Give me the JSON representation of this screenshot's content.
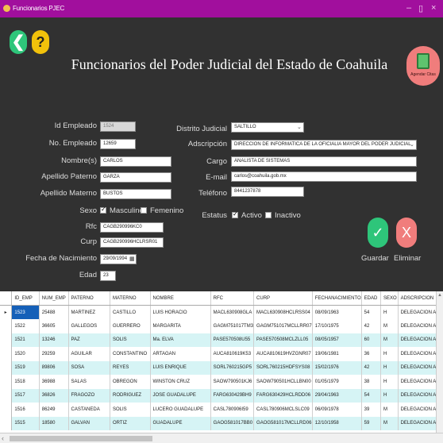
{
  "window": {
    "title": "Funcionarios PJEC",
    "min": "–",
    "max": "▯",
    "close": "×"
  },
  "header": {
    "back_glyph": "❮",
    "help_glyph": "?",
    "title": "Funcionarios del Poder Judicial del Estado de Coahuila",
    "badge_text": "Agendar Citas"
  },
  "form": {
    "id_empleado": {
      "label": "Id Empleado",
      "value": "1524"
    },
    "no_empleado": {
      "label": "No. Empleado",
      "value": "12659"
    },
    "nombre": {
      "label": "Nombre(s)",
      "value": "CARLOS"
    },
    "apellido_paterno": {
      "label": "Apellido Paterno",
      "value": "GARZA"
    },
    "apellido_materno": {
      "label": "Apellido Materno",
      "value": "BUSTOS"
    },
    "sexo": {
      "label": "Sexo",
      "opt1": "Masculino",
      "opt2": "Femenino"
    },
    "rfc": {
      "label": "Rfc",
      "value": "CAGB290996KC0"
    },
    "curp": {
      "label": "Curp",
      "value": "CAGB290996HCLRSR01"
    },
    "fecha_nac": {
      "label": "Fecha de Nacimiento",
      "value": "29/09/1994"
    },
    "edad": {
      "label": "Edad",
      "value": "23"
    },
    "distrito": {
      "label": "Distrito Judicial",
      "value": "SALTILLO"
    },
    "adscripcion": {
      "label": "Adscripción",
      "value": "DIRECCION DE INFORMATICA DE LA OFICIALIA MAYOR DEL PODER JUDICIAL"
    },
    "cargo": {
      "label": "Cargo",
      "value": "ANALISTA DE SISTEMAS"
    },
    "email": {
      "label": "E-mail",
      "value": "carlos@coahuila.gob.mx"
    },
    "telefono": {
      "label": "Teléfono",
      "value": "8441237878"
    },
    "estatus": {
      "label": "Estatus",
      "opt1": "Activo",
      "opt2": "Inactivo"
    }
  },
  "actions": {
    "save_glyph": "✓",
    "save_label": "Guardar",
    "delete_glyph": "X",
    "delete_label": "Eliminar"
  },
  "table": {
    "columns": [
      "ID_EMP",
      "NUM_EMP",
      "PATERNO",
      "MATERNO",
      "NOMBRE",
      "RFC",
      "CURP",
      "FECHANACIMIENTO",
      "EDAD",
      "SEXO",
      "ADSCRIPCION"
    ],
    "rows": [
      [
        "1523",
        "25488",
        "MARTINEZ",
        "CASTILLO",
        "LUIS HORACIO",
        "MACL630908GLA",
        "MACL630908HCLRSS04",
        "08/09/1963",
        "54",
        "H",
        "DELEGACION ACL"
      ],
      [
        "1522",
        "36605",
        "GALLEGOS",
        "GUERRERO",
        "MARGARITA",
        "GAGM751017TM3",
        "GAGM751017MCLLRR07",
        "17/10/1975",
        "42",
        "M",
        "DELEGACION ACL"
      ],
      [
        "1521",
        "13246",
        "PAZ",
        "SOLIS",
        "Ma. ELVA",
        "PASE570508U55",
        "PASE570508MCLZLL05",
        "08/05/1957",
        "60",
        "M",
        "DELEGACION ACL"
      ],
      [
        "1520",
        "29259",
        "AGUILAR",
        "CONSTANTINO",
        "ARTAGAN",
        "AUCA810619K53",
        "AUCA810619HVZGNR07",
        "19/06/1981",
        "36",
        "H",
        "DELEGACION ACL"
      ],
      [
        "1519",
        "89806",
        "SOSA",
        "REYES",
        "LUIS ENRIQUE",
        "SORL760215GP5",
        "SORL760215HDFSYS08",
        "15/02/1976",
        "42",
        "H",
        "DELEGACION ACL"
      ],
      [
        "1518",
        "36988",
        "SALAS",
        "OBREGON",
        "WINSTON CRUZ",
        "SAOW790501KJ6",
        "SAOW790501HCLLBN00",
        "01/05/1979",
        "38",
        "H",
        "DELEGACION ACL"
      ],
      [
        "1517",
        "36826",
        "FRAGOZO",
        "RODRIGUEZ",
        "JOSE GUADALUPE",
        "FARG630429BH9",
        "FARG630429HCLRDD06",
        "29/04/1963",
        "54",
        "H",
        "DELEGACION ACL"
      ],
      [
        "1516",
        "86249",
        "CASTANEDA",
        "SOLIS",
        "LUCERO GUADALUPE",
        "CASL780906I59",
        "CASL780906MCLSLC09",
        "06/09/1978",
        "39",
        "M",
        "DELEGACION ACL"
      ],
      [
        "1515",
        "18580",
        "GALVAN",
        "ORTIZ",
        "GUADALUPE",
        "GAOG581017BB0",
        "GAOG581017MCLLRD06",
        "12/10/1958",
        "59",
        "M",
        "DELEGACION ACL"
      ]
    ]
  },
  "colors": {
    "titlebar": "#a10f9d",
    "back": "#2ec57a",
    "help": "#f1c10b",
    "save": "#2ec57a",
    "delete": "#f07d7c",
    "selected_row": "#1560b8",
    "alt_row": "#d6f4f5"
  }
}
